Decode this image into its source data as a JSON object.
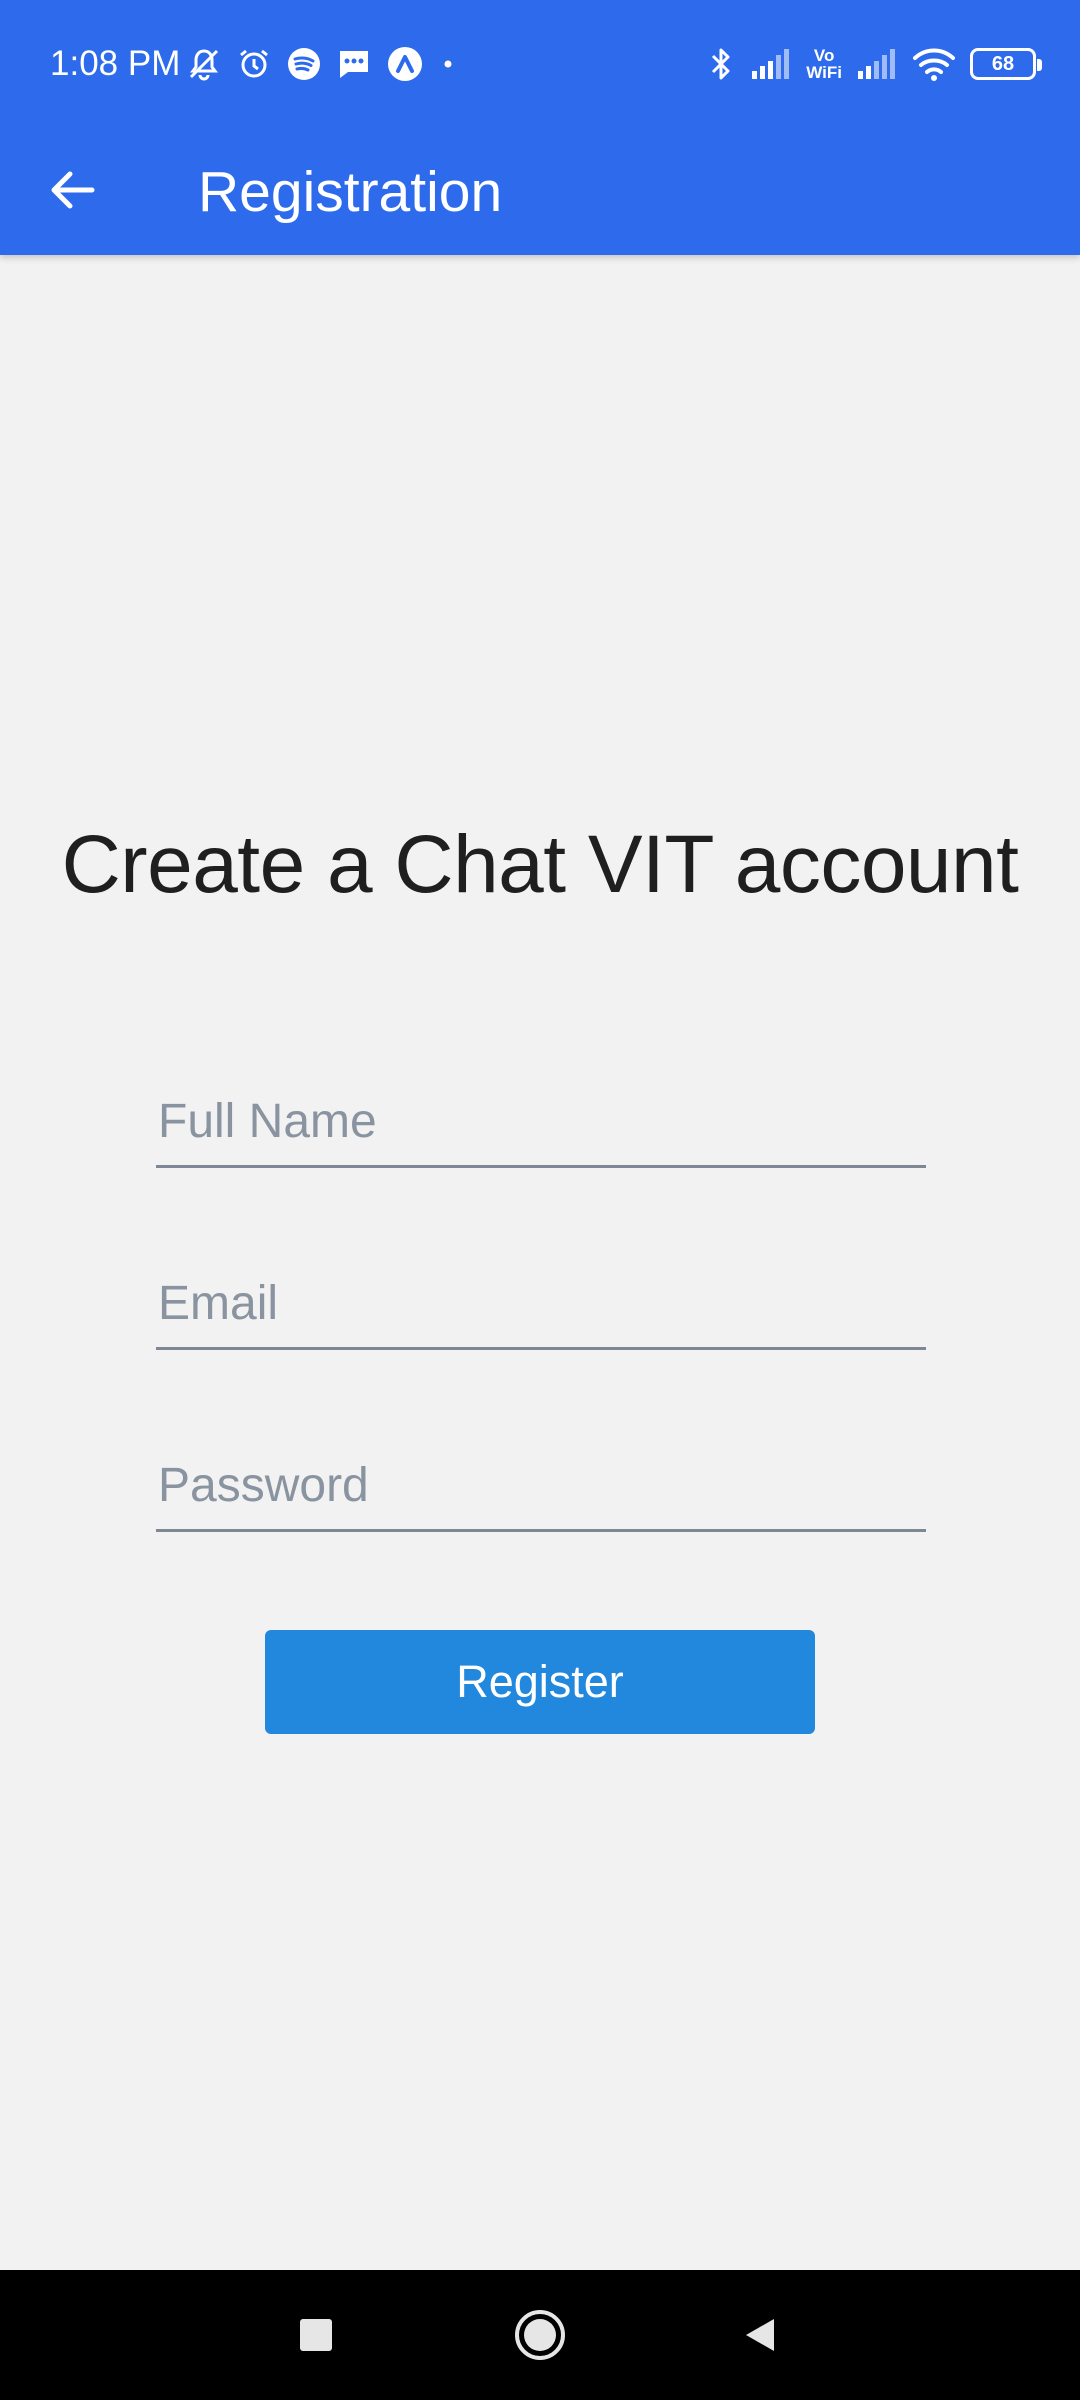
{
  "status_bar": {
    "time": "1:08 PM",
    "left_icons": [
      "mute-notification-icon",
      "alarm-icon",
      "spotify-icon",
      "messages-icon",
      "arc-app-icon",
      "dot-icon"
    ],
    "right_icons": [
      "bluetooth-icon",
      "signal-icon",
      "vowifi-icon",
      "signal-icon",
      "wifi-icon",
      "battery-icon"
    ],
    "vowifi_label": "Vo\nWiFi",
    "battery_level": "68"
  },
  "app_bar": {
    "title": "Registration",
    "back_icon": "arrow-left-icon",
    "color": "#2d6bec"
  },
  "main": {
    "heading": "Create a Chat VIT account",
    "fields": {
      "full_name": {
        "placeholder": "Full Name",
        "value": ""
      },
      "email": {
        "placeholder": "Email",
        "value": ""
      },
      "password": {
        "placeholder": "Password",
        "value": ""
      }
    },
    "register_button": {
      "label": "Register",
      "color": "#2188dd"
    }
  },
  "nav_bar": {
    "buttons": [
      "recents-square-icon",
      "home-circle-icon",
      "back-triangle-icon"
    ]
  }
}
